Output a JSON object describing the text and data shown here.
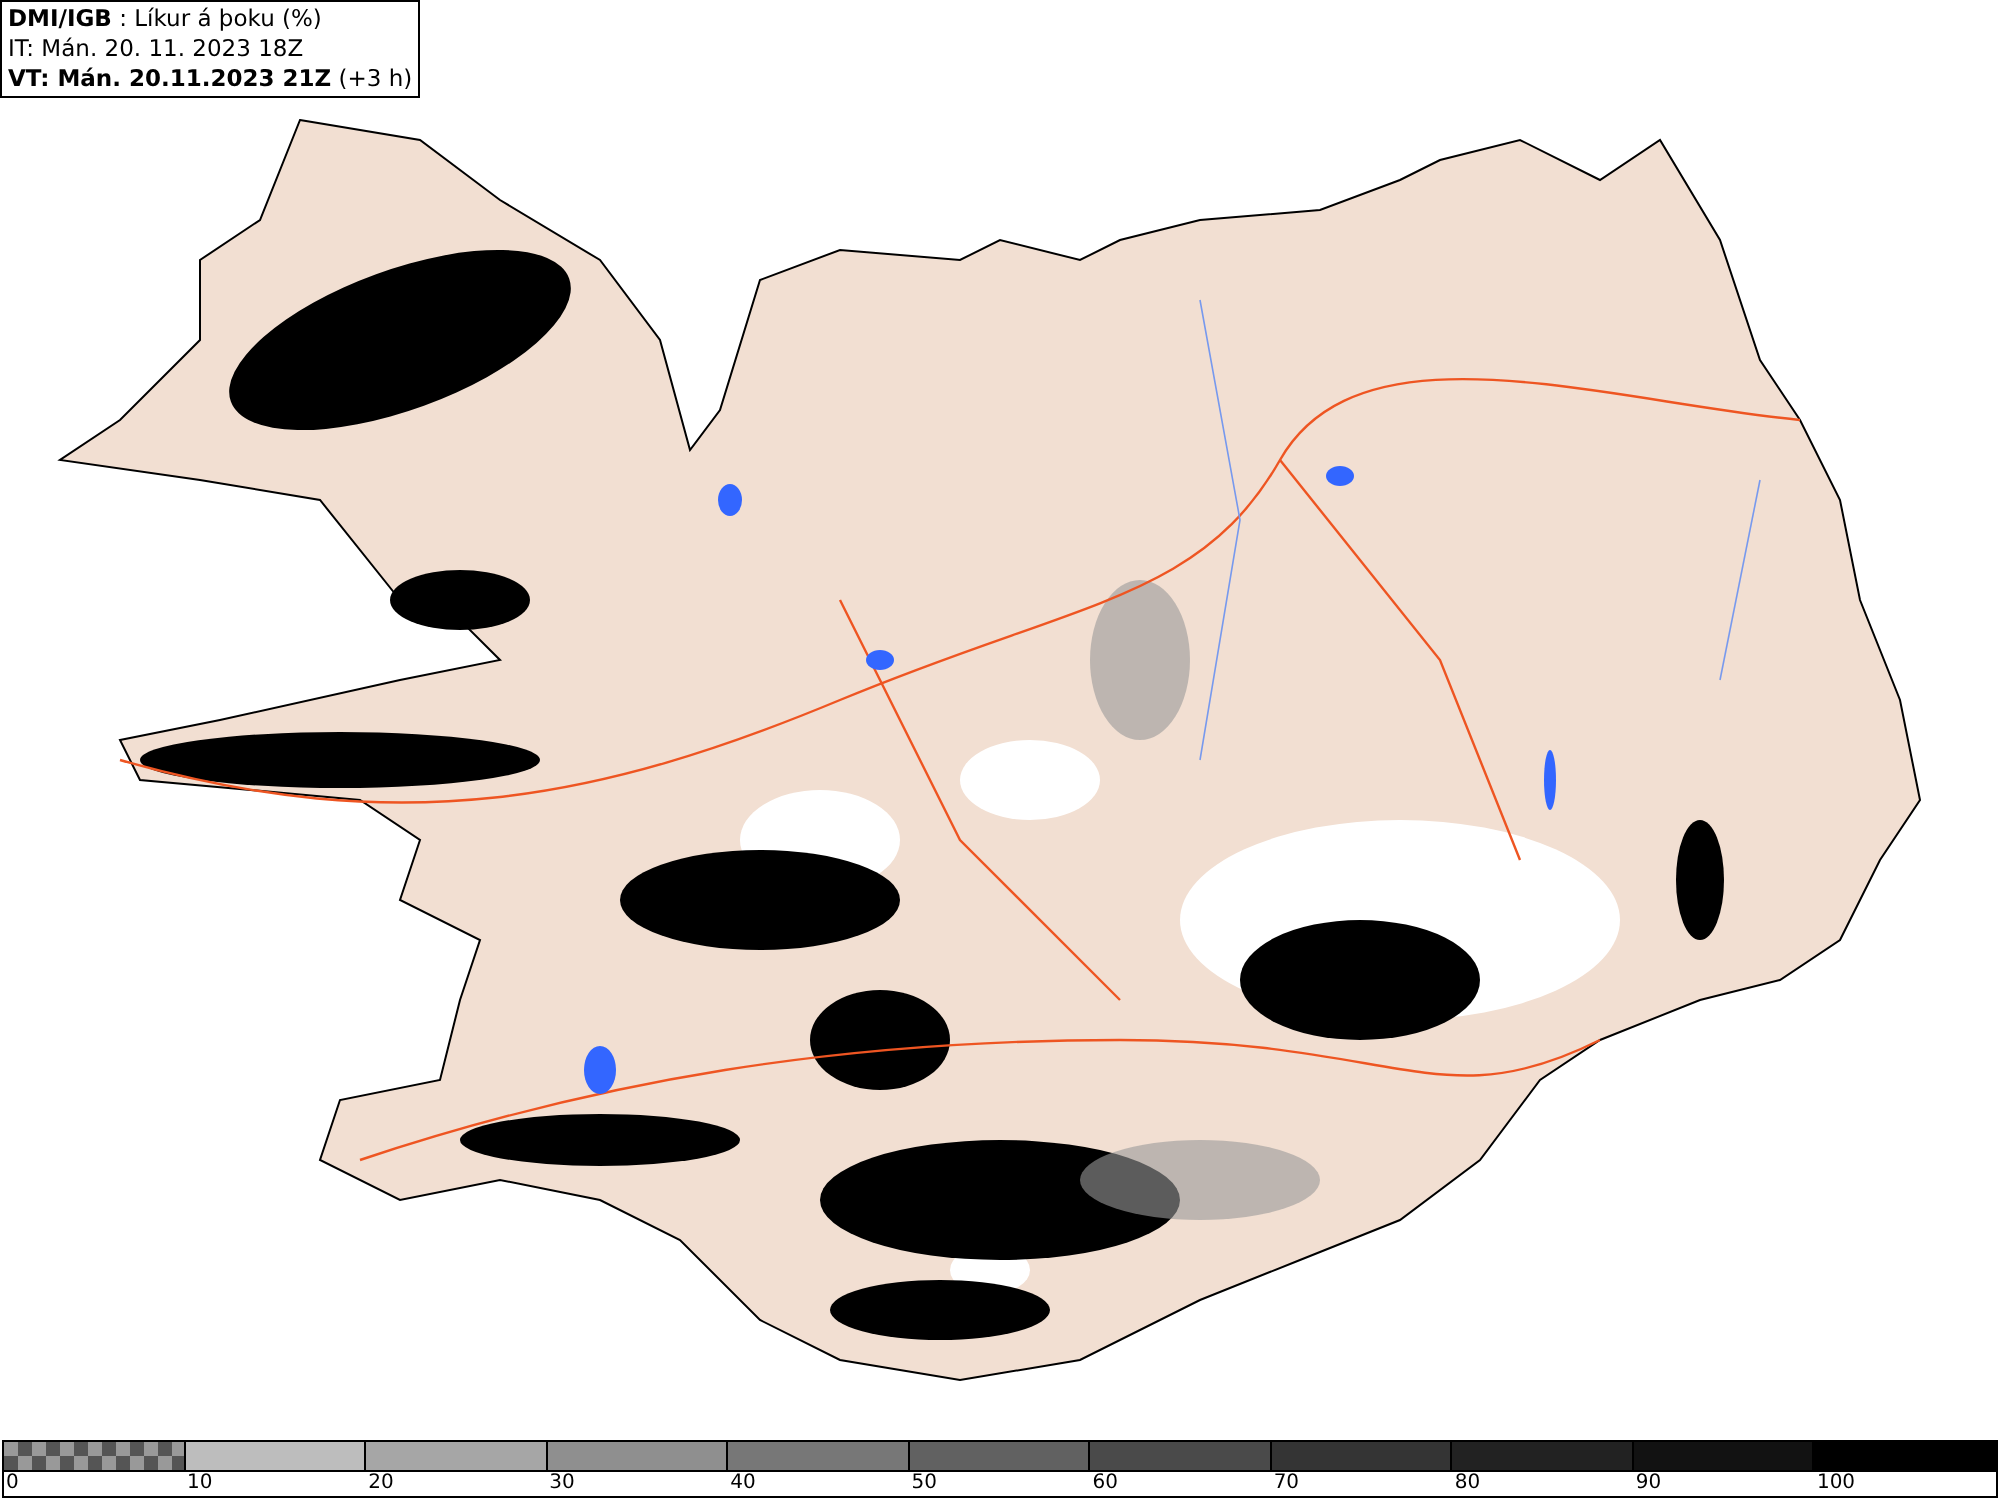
{
  "header": {
    "lines": [
      "**DMI/IGB** : Líkur á þoku (%)",
      "IT: Mán. 20. 11. 2023 18Z",
      "**VT: Mán. 20.11.2023 21Z** (+3 h)"
    ]
  },
  "legend": {
    "segments": [
      {
        "kind": "checker",
        "label": "0"
      },
      {
        "kind": "solid",
        "color": "#bdbdbd",
        "label": "10"
      },
      {
        "kind": "solid",
        "color": "#a6a6a6",
        "label": "20"
      },
      {
        "kind": "solid",
        "color": "#8f8f8f",
        "label": "30"
      },
      {
        "kind": "solid",
        "color": "#777777",
        "label": "40"
      },
      {
        "kind": "solid",
        "color": "#616161",
        "label": "50"
      },
      {
        "kind": "solid",
        "color": "#4a4a4a",
        "label": "60"
      },
      {
        "kind": "solid",
        "color": "#343434",
        "label": "70"
      },
      {
        "kind": "solid",
        "color": "#222222",
        "label": "80"
      },
      {
        "kind": "solid",
        "color": "#121212",
        "label": "90"
      },
      {
        "kind": "solid",
        "color": "#000000",
        "label": "100"
      }
    ]
  }
}
